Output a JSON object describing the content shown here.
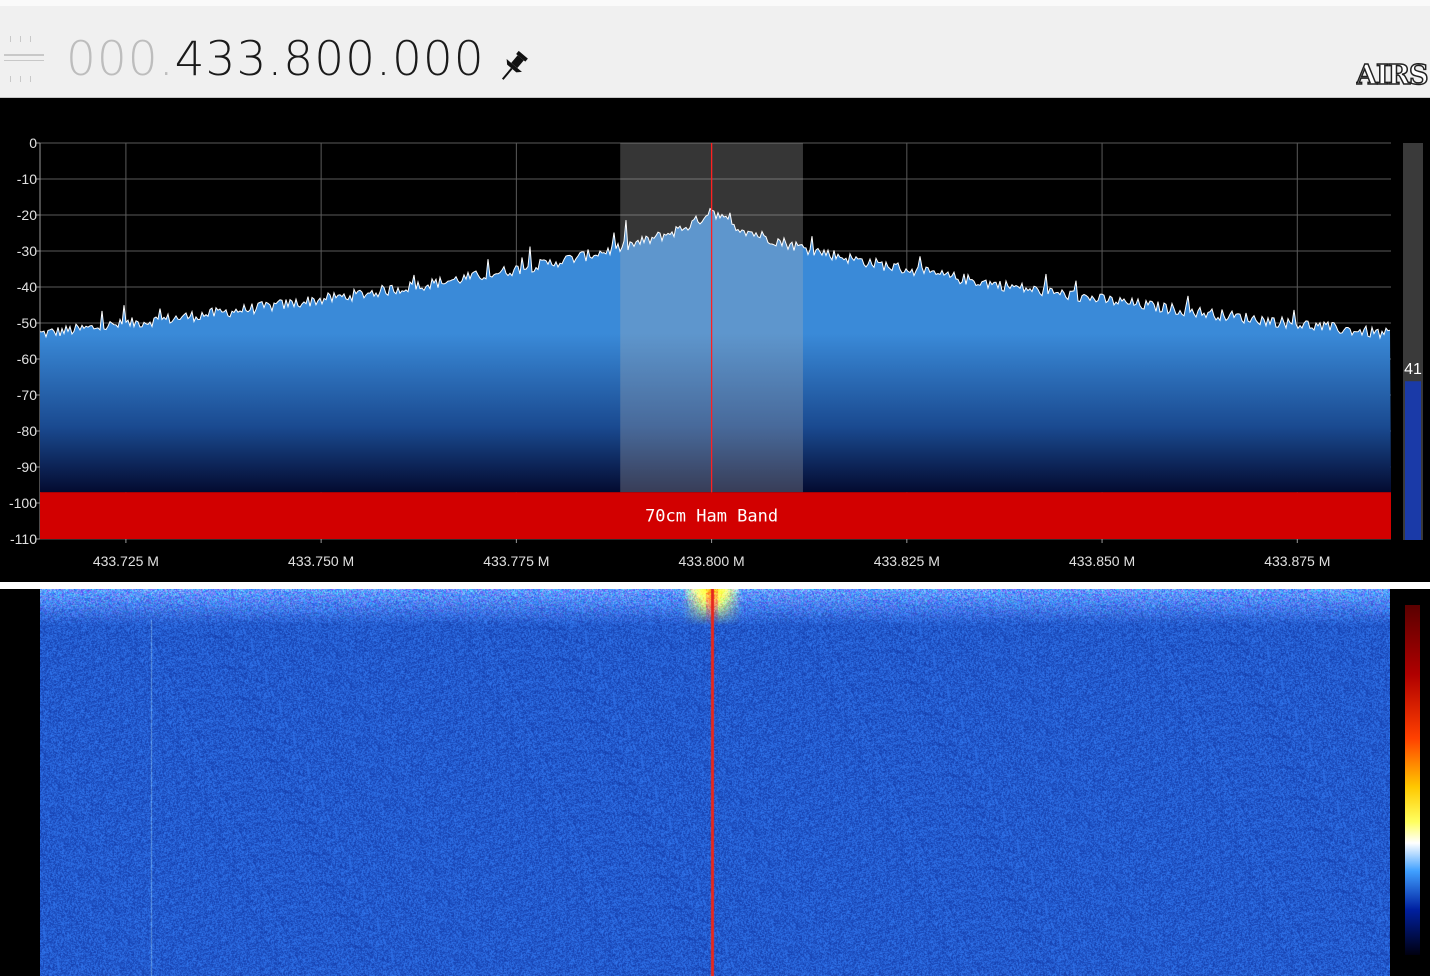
{
  "app": {
    "frequency_prefix": "000.",
    "frequency_main": "433.800.000",
    "logo_text": "AIRS"
  },
  "spectrum": {
    "db_ticks": [
      "0",
      "-10",
      "-20",
      "-30",
      "-40",
      "-50",
      "-60",
      "-70",
      "-80",
      "-90",
      "-100",
      "-110"
    ],
    "freq_ticks": [
      "433.725 M",
      "433.750 M",
      "433.775 M",
      "433.800 M",
      "433.825 M",
      "433.850 M",
      "433.875 M"
    ],
    "band_label": "70cm Ham Band",
    "gain_value": "41",
    "gain_fraction": 0.41,
    "center_freq_mhz": 433.8,
    "span_mhz": [
      433.714,
      433.887
    ],
    "db_range": [
      -110,
      0
    ],
    "noise_floor_db": -53,
    "peak_db": -17,
    "colors": {
      "trace": "#ffffff",
      "fill_top": "#3a8ad8",
      "fill_bottom": "#000020",
      "band": "#d20000",
      "center_line": "#ff2020",
      "filter": "#b4b4b4",
      "grid": "#5a5a5a",
      "gain_bar": "#1a3aa8"
    }
  },
  "waterfall": {
    "colors": {
      "background": "#1e50c0",
      "signal_hot": "#ffd000",
      "signal_core": "#c00000"
    }
  },
  "icons": {
    "pin": "pushpin-icon",
    "handle": "tuning-handle-icon"
  }
}
